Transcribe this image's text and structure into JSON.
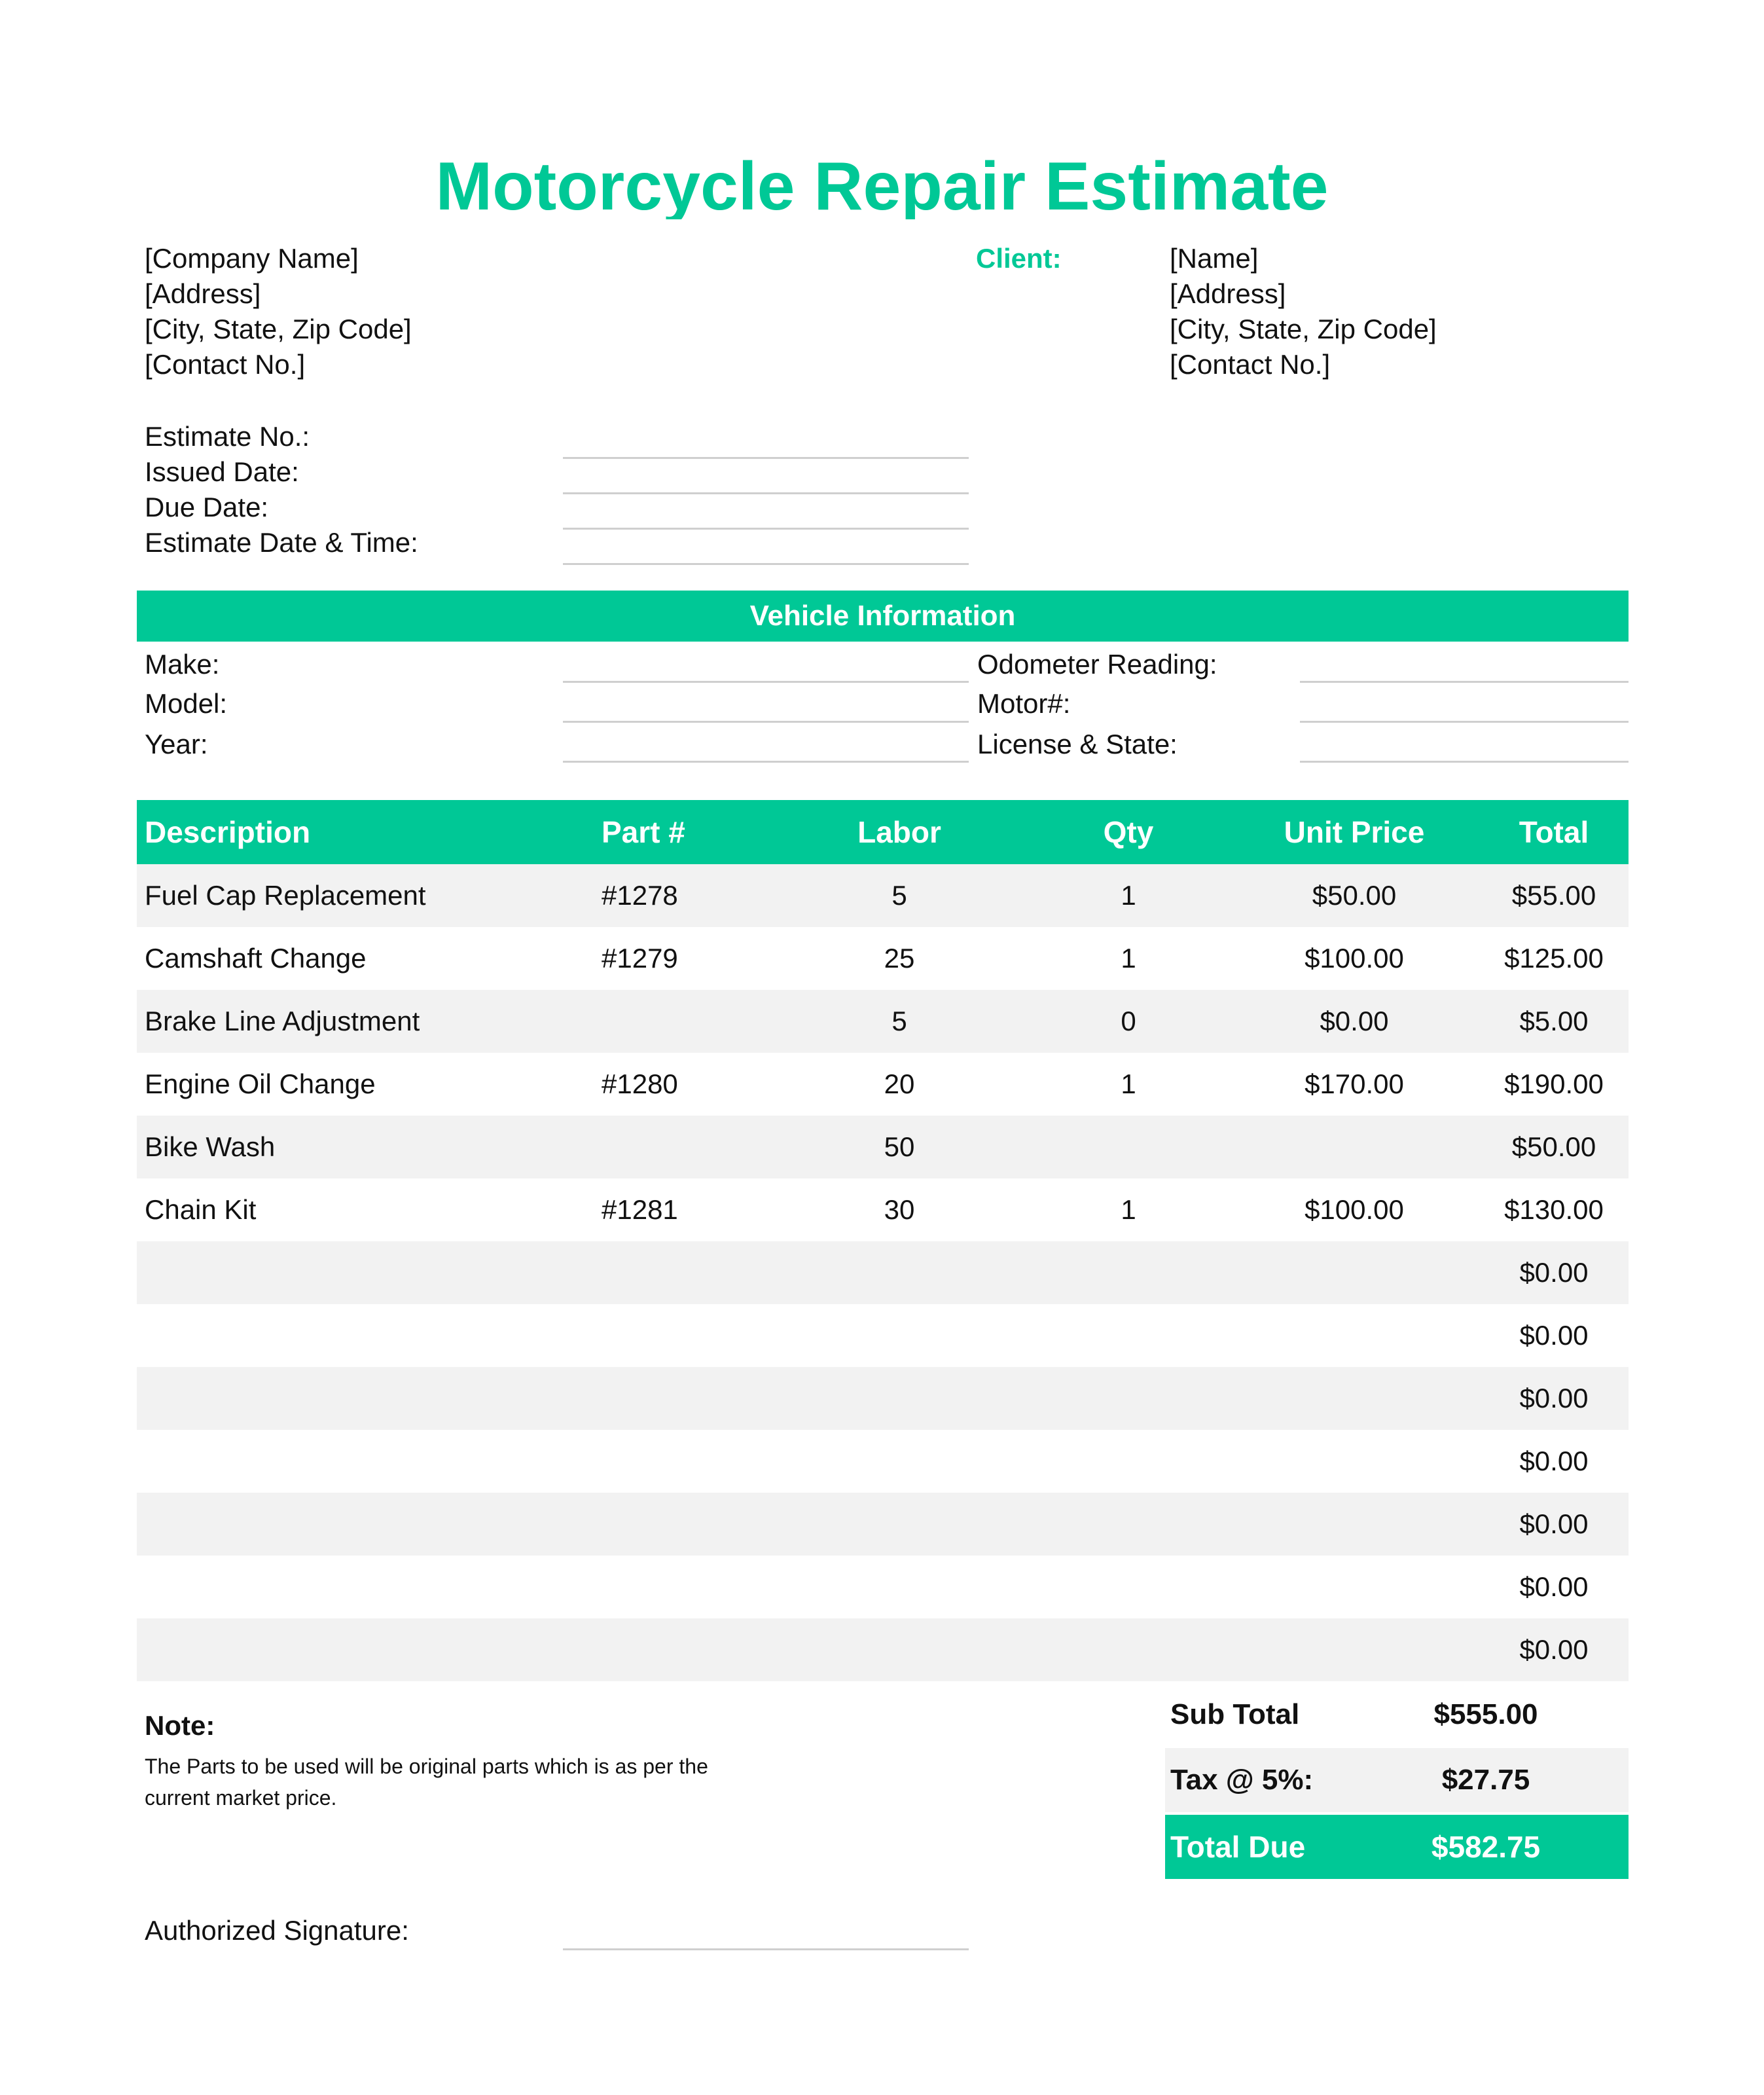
{
  "title": "Motorcycle Repair Estimate",
  "company": [
    "[Company Name]",
    "[Address]",
    "[City, State, Zip Code]",
    "[Contact No.]"
  ],
  "client": {
    "label": "Client:",
    "lines": [
      "[Name]",
      "[Address]",
      "[City, State, Zip Code]",
      "[Contact No.]"
    ]
  },
  "estimate_fields": [
    "Estimate No.:",
    "Issued Date:",
    "Due Date:",
    "Estimate Date & Time:"
  ],
  "vehicle": {
    "heading": "Vehicle Information",
    "left": [
      "Make:",
      "Model:",
      "Year:"
    ],
    "right": [
      "Odometer Reading:",
      "Motor#:",
      "License & State:"
    ]
  },
  "table": {
    "headers": {
      "description": "Description",
      "part": "Part #",
      "labor": "Labor",
      "qty": "Qty",
      "unit_price": "Unit Price",
      "total": "Total"
    },
    "rows": [
      {
        "description": "Fuel Cap Replacement",
        "part": "#1278",
        "labor": "5",
        "qty": "1",
        "unit_price": "$50.00",
        "total": "$55.00"
      },
      {
        "description": "Camshaft  Change",
        "part": "#1279",
        "labor": "25",
        "qty": "1",
        "unit_price": "$100.00",
        "total": "$125.00"
      },
      {
        "description": "Brake Line Adjustment",
        "part": "",
        "labor": "5",
        "qty": "0",
        "unit_price": "$0.00",
        "total": "$5.00"
      },
      {
        "description": "Engine Oil Change",
        "part": "#1280",
        "labor": "20",
        "qty": "1",
        "unit_price": "$170.00",
        "total": "$190.00"
      },
      {
        "description": "Bike Wash",
        "part": "",
        "labor": "50",
        "qty": "",
        "unit_price": "",
        "total": "$50.00"
      },
      {
        "description": "Chain Kit",
        "part": "#1281",
        "labor": "30",
        "qty": "1",
        "unit_price": "$100.00",
        "total": "$130.00"
      },
      {
        "description": "",
        "part": "",
        "labor": "",
        "qty": "",
        "unit_price": "",
        "total": "$0.00"
      },
      {
        "description": "",
        "part": "",
        "labor": "",
        "qty": "",
        "unit_price": "",
        "total": "$0.00"
      },
      {
        "description": "",
        "part": "",
        "labor": "",
        "qty": "",
        "unit_price": "",
        "total": "$0.00"
      },
      {
        "description": "",
        "part": "",
        "labor": "",
        "qty": "",
        "unit_price": "",
        "total": "$0.00"
      },
      {
        "description": "",
        "part": "",
        "labor": "",
        "qty": "",
        "unit_price": "",
        "total": "$0.00"
      },
      {
        "description": "",
        "part": "",
        "labor": "",
        "qty": "",
        "unit_price": "",
        "total": "$0.00"
      },
      {
        "description": "",
        "part": "",
        "labor": "",
        "qty": "",
        "unit_price": "",
        "total": "$0.00"
      }
    ]
  },
  "note": {
    "title": "Note:",
    "body": "The Parts to be used will be original parts which is as per the current market price."
  },
  "summary": {
    "subtotal_label": "Sub Total",
    "subtotal": "$555.00",
    "tax_label": "Tax @ 5%:",
    "tax": "$27.75",
    "total_label": "Total Due",
    "total": "$582.75"
  },
  "signature_label": "Authorized Signature:",
  "colors": {
    "accent": "#00c896",
    "row_alt": "#f2f2f2",
    "rule": "#cfcfcf"
  }
}
